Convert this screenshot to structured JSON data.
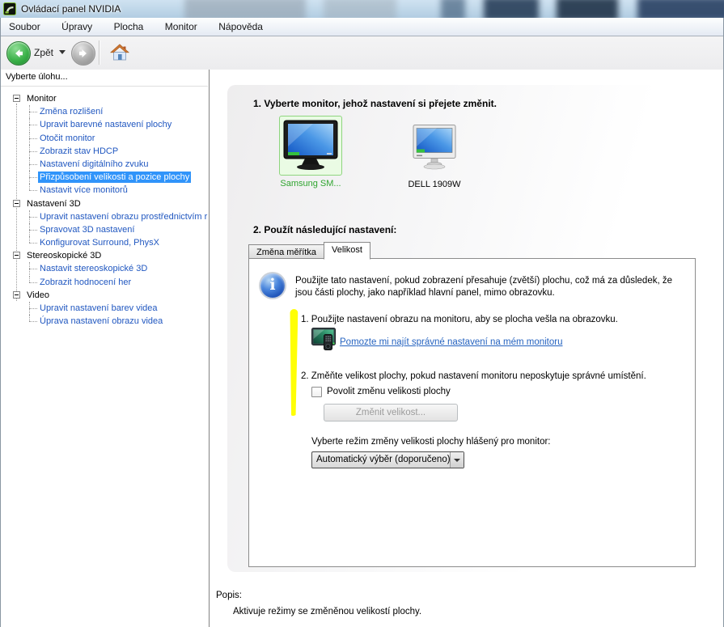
{
  "window": {
    "title": "Ovládací panel NVIDIA"
  },
  "menu": {
    "items": [
      "Soubor",
      "Úpravy",
      "Plocha",
      "Monitor",
      "Nápověda"
    ]
  },
  "toolbar": {
    "back_label": "Zpět"
  },
  "sidebar": {
    "header": "Vyberte úlohu...",
    "tree": [
      {
        "label": "Monitor",
        "type": "root"
      },
      {
        "label": "Změna rozlišení",
        "type": "child"
      },
      {
        "label": "Upravit barevné nastavení plochy",
        "type": "child"
      },
      {
        "label": "Otočit monitor",
        "type": "child"
      },
      {
        "label": "Zobrazit stav HDCP",
        "type": "child"
      },
      {
        "label": "Nastavení digitálního zvuku",
        "type": "child"
      },
      {
        "label": "Přizpůsobení velikosti a pozice plochy",
        "type": "child",
        "selected": true
      },
      {
        "label": "Nastavit více monitorů",
        "type": "child"
      },
      {
        "label": "Nastavení 3D",
        "type": "root"
      },
      {
        "label": "Upravit nastavení obrazu prostřednictvím r",
        "type": "child"
      },
      {
        "label": "Spravovat 3D nastavení",
        "type": "child"
      },
      {
        "label": "Konfigurovat Surround, PhysX",
        "type": "child"
      },
      {
        "label": "Stereoskopické 3D",
        "type": "root"
      },
      {
        "label": "Nastavit stereoskopické 3D",
        "type": "child"
      },
      {
        "label": "Zobrazit hodnocení her",
        "type": "child"
      },
      {
        "label": "Video",
        "type": "root"
      },
      {
        "label": "Upravit nastavení barev videa",
        "type": "child"
      },
      {
        "label": "Úprava nastavení obrazu videa",
        "type": "child"
      }
    ]
  },
  "main": {
    "step1_heading": "1. Vyberte monitor, jehož nastavení si přejete změnit.",
    "monitors": [
      {
        "name": "Samsung SM...",
        "selected": true
      },
      {
        "name": "DELL 1909W",
        "selected": false
      }
    ],
    "step2_heading": "2. Použít následující nastavení:",
    "tabs": [
      {
        "label": "Změna měřítka",
        "active": false
      },
      {
        "label": "Velikost",
        "active": true
      }
    ],
    "panel": {
      "info_text": "Použijte tato nastavení, pokud zobrazení přesahuje (zvětší) plochu, což má za důsledek, že jsou části plochy, jako například hlavní panel, mimo obrazovku.",
      "item1": "1. Použijte nastavení obrazu na monitoru, aby se plocha vešla na obrazovku.",
      "link": "Pomozte mi najít správné nastavení na mém monitoru",
      "item2": "2. Změňte velikost plochy, pokud nastavení monitoru neposkytuje správné umístění.",
      "checkbox_label": "Povolit změnu velikosti plochy",
      "checkbox_checked": false,
      "button_label": "Změnit velikost...",
      "combo_label": "Vyberte režim změny velikosti plochy hlášený pro monitor:",
      "combo_value": "Automatický výběr (doporučeno)"
    }
  },
  "footer": {
    "popis_label": "Popis:",
    "description": "Aktivuje režimy se změněnou velikostí plochy."
  },
  "icons": {
    "app": "nvidia-logo-icon",
    "back": "back-arrow-icon",
    "forward": "forward-arrow-icon",
    "home": "home-icon",
    "info": "info-icon",
    "monitor_selected": "monitor-icon",
    "monitor_second": "monitor-icon",
    "tv_remote": "tv-remote-icon",
    "combo_arrow": "chevron-down-icon",
    "tree_toggle": "minus-box-icon"
  },
  "colors": {
    "selection_blue": "#3094fa",
    "tree_link_blue": "#2057c0",
    "hyperlink_blue": "#2563c0",
    "highlight_yellow": "#ffff05",
    "monitor_selected_border": "#8fd57f",
    "monitor_selected_bg": "#eafbe4",
    "monitor_label_green": "#2fa52f",
    "back_button_green": "#3cb24a"
  }
}
